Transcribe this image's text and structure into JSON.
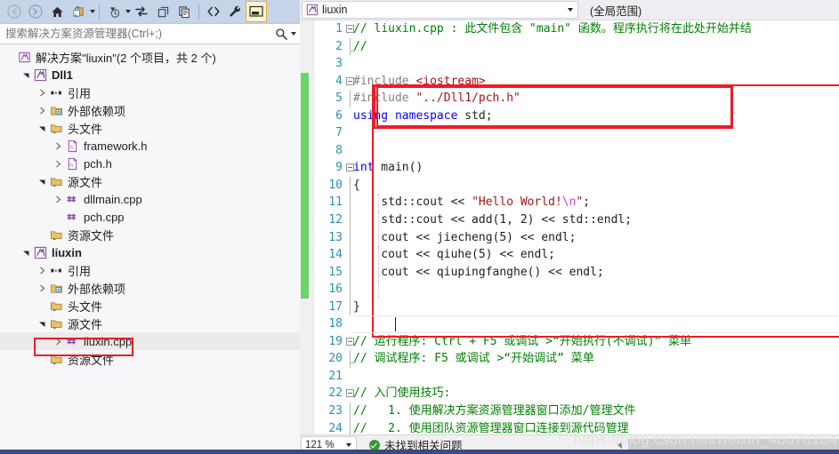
{
  "solution_explorer": {
    "toolbar": {
      "buttons": [
        {
          "name": "back-icon",
          "glyph": "back"
        },
        {
          "name": "forward-icon",
          "glyph": "forward"
        },
        {
          "name": "home-icon",
          "glyph": "home"
        },
        {
          "name": "sync-with-active-document-icon",
          "glyph": "syncdoc"
        },
        {
          "name": "pending-changes-filter-icon",
          "glyph": "clock"
        },
        {
          "name": "refresh-icon",
          "glyph": "refresh"
        },
        {
          "name": "collapse-all-icon",
          "glyph": "collapse"
        },
        {
          "name": "show-all-files-icon",
          "glyph": "allfiles"
        },
        {
          "name": "view-code-icon",
          "glyph": "code"
        },
        {
          "name": "properties-icon",
          "glyph": "wrench"
        },
        {
          "name": "preview-selected-items-icon",
          "glyph": "preview"
        }
      ]
    },
    "search": {
      "placeholder": "搜索解决方案资源管理器(Ctrl+;)",
      "value": ""
    },
    "tree": [
      {
        "depth": 0,
        "label": "解决方案\"liuxin\"(2 个项目，共 2 个)",
        "icon": "solution-icon",
        "expander": "none",
        "bold": false,
        "selected": false
      },
      {
        "depth": 1,
        "label": "Dll1",
        "icon": "project-icon",
        "expander": "expanded",
        "bold": true,
        "selected": false
      },
      {
        "depth": 2,
        "label": "引用",
        "icon": "references-icon",
        "expander": "collapsed",
        "bold": false,
        "selected": false
      },
      {
        "depth": 2,
        "label": "外部依赖项",
        "icon": "external-deps-icon",
        "expander": "collapsed",
        "bold": false,
        "selected": false
      },
      {
        "depth": 2,
        "label": "头文件",
        "icon": "filter-folder-icon",
        "expander": "expanded",
        "bold": false,
        "selected": false
      },
      {
        "depth": 3,
        "label": "framework.h",
        "icon": "header-file-icon",
        "expander": "collapsed",
        "bold": false,
        "selected": false
      },
      {
        "depth": 3,
        "label": "pch.h",
        "icon": "header-file-icon",
        "expander": "collapsed",
        "bold": false,
        "selected": false
      },
      {
        "depth": 2,
        "label": "源文件",
        "icon": "filter-folder-icon",
        "expander": "expanded",
        "bold": false,
        "selected": false
      },
      {
        "depth": 3,
        "label": "dllmain.cpp",
        "icon": "cpp-file-icon",
        "expander": "collapsed",
        "bold": false,
        "selected": false
      },
      {
        "depth": 3,
        "label": "pch.cpp",
        "icon": "cpp-file-icon",
        "expander": "none",
        "bold": false,
        "selected": false
      },
      {
        "depth": 2,
        "label": "资源文件",
        "icon": "filter-folder-icon",
        "expander": "none",
        "bold": false,
        "selected": false
      },
      {
        "depth": 1,
        "label": "liuxin",
        "icon": "project-icon",
        "expander": "expanded",
        "bold": true,
        "selected": false
      },
      {
        "depth": 2,
        "label": "引用",
        "icon": "references-icon",
        "expander": "collapsed",
        "bold": false,
        "selected": false
      },
      {
        "depth": 2,
        "label": "外部依赖项",
        "icon": "external-deps-icon",
        "expander": "collapsed",
        "bold": false,
        "selected": false
      },
      {
        "depth": 2,
        "label": "头文件",
        "icon": "filter-folder-icon",
        "expander": "none",
        "bold": false,
        "selected": false
      },
      {
        "depth": 2,
        "label": "源文件",
        "icon": "filter-folder-icon",
        "expander": "expanded",
        "bold": false,
        "selected": false
      },
      {
        "depth": 3,
        "label": "liuxin.cpp",
        "icon": "cpp-file-icon",
        "expander": "collapsed",
        "bold": false,
        "selected": true
      },
      {
        "depth": 2,
        "label": "资源文件",
        "icon": "filter-folder-icon",
        "expander": "none",
        "bold": false,
        "selected": false
      }
    ]
  },
  "editor": {
    "nav_left": "liuxin",
    "nav_right": "(全局范围)",
    "lines": [
      {
        "n": 1,
        "html": "<span class=\"cm\">// liuxin.cpp : 此文件包含 \"main\" 函数。程序执行将在此处开始并结</span>",
        "fold": "start",
        "guide": false,
        "changed": false
      },
      {
        "n": 2,
        "html": "<span class=\"cm\">//</span>",
        "fold": "end",
        "guide": false,
        "changed": false
      },
      {
        "n": 3,
        "html": "",
        "fold": "none",
        "guide": false,
        "changed": false
      },
      {
        "n": 4,
        "html": "<span class=\"pp\">#include</span> <span class=\"str\">&lt;iostream&gt;</span>",
        "fold": "start",
        "guide": false,
        "changed": false
      },
      {
        "n": 5,
        "html": "<span class=\"pp\">#include</span> <span class=\"str\">\"../Dll1/pch.h\"</span>",
        "fold": "mid",
        "guide": false,
        "changed": true
      },
      {
        "n": 6,
        "html": "<span class=\"kw\">using</span> <span class=\"kw\">namespace</span> std;",
        "fold": "none",
        "guide": false,
        "changed": true
      },
      {
        "n": 7,
        "html": "",
        "fold": "none",
        "guide": false,
        "changed": true
      },
      {
        "n": 8,
        "html": "",
        "fold": "none",
        "guide": false,
        "changed": true
      },
      {
        "n": 9,
        "html": "<span class=\"kw\">int</span> main()",
        "fold": "start",
        "guide": false,
        "changed": true
      },
      {
        "n": 10,
        "html": "{",
        "fold": "mid",
        "guide": false,
        "changed": true
      },
      {
        "n": 11,
        "html": "    std::cout &lt;&lt; <span class=\"str\">\"Hello World!</span><span class=\"esc\">\\n</span><span class=\"str\">\"</span>;",
        "fold": "mid",
        "guide": true,
        "changed": true
      },
      {
        "n": 12,
        "html": "    std::cout &lt;&lt; add(1, 2) &lt;&lt; std::endl;",
        "fold": "mid",
        "guide": true,
        "changed": true
      },
      {
        "n": 13,
        "html": "    cout &lt;&lt; jiecheng(5) &lt;&lt; endl;",
        "fold": "mid",
        "guide": true,
        "changed": true
      },
      {
        "n": 14,
        "html": "    cout &lt;&lt; qiuhe(5) &lt;&lt; endl;",
        "fold": "mid",
        "guide": true,
        "changed": true
      },
      {
        "n": 15,
        "html": "    cout &lt;&lt; qiupingfanghe() &lt;&lt; endl;",
        "fold": "mid",
        "guide": true,
        "changed": true
      },
      {
        "n": 16,
        "html": "",
        "fold": "mid",
        "guide": true,
        "changed": true
      },
      {
        "n": 17,
        "html": "}",
        "fold": "mid",
        "guide": false,
        "changed": true
      },
      {
        "n": 18,
        "html": "",
        "fold": "none",
        "guide": false,
        "changed": false
      },
      {
        "n": 19,
        "html": "<span class=\"cm\">// 运行程序: Ctrl + F5 或调试 &gt;“开始执行(不调试)” 菜单</span>",
        "fold": "start",
        "guide": false,
        "changed": false
      },
      {
        "n": 20,
        "html": "<span class=\"cm\">// 调试程序: F5 或调试 &gt;“开始调试” 菜单</span>",
        "fold": "end",
        "guide": false,
        "changed": false
      },
      {
        "n": 21,
        "html": "",
        "fold": "none",
        "guide": false,
        "changed": false
      },
      {
        "n": 22,
        "html": "<span class=\"cm\">// 入门使用技巧:</span>",
        "fold": "start",
        "guide": false,
        "changed": false
      },
      {
        "n": 23,
        "html": "<span class=\"cm\">//   1. 使用解决方案资源管理器窗口添加/管理文件</span>",
        "fold": "mid",
        "guide": false,
        "changed": false
      },
      {
        "n": 24,
        "html": "<span class=\"cm\">//   2. 使用团队资源管理器窗口连接到源代码管理</span>",
        "fold": "mid",
        "guide": false,
        "changed": false
      }
    ]
  },
  "status_bar": {
    "zoom": "121 %",
    "message": "未找到相关问题",
    "watermark": "https://blog.csdn.net/weixin_48678164"
  },
  "colors": {
    "accent": "#ee1c25",
    "comment": "#008000",
    "keyword": "#0000ff",
    "string": "#a31515",
    "line_number": "#2b91af",
    "change_bar": "#6cd46c",
    "toolbar_bg": "#c6d4ea",
    "panel_bg": "#f5f5f8"
  }
}
